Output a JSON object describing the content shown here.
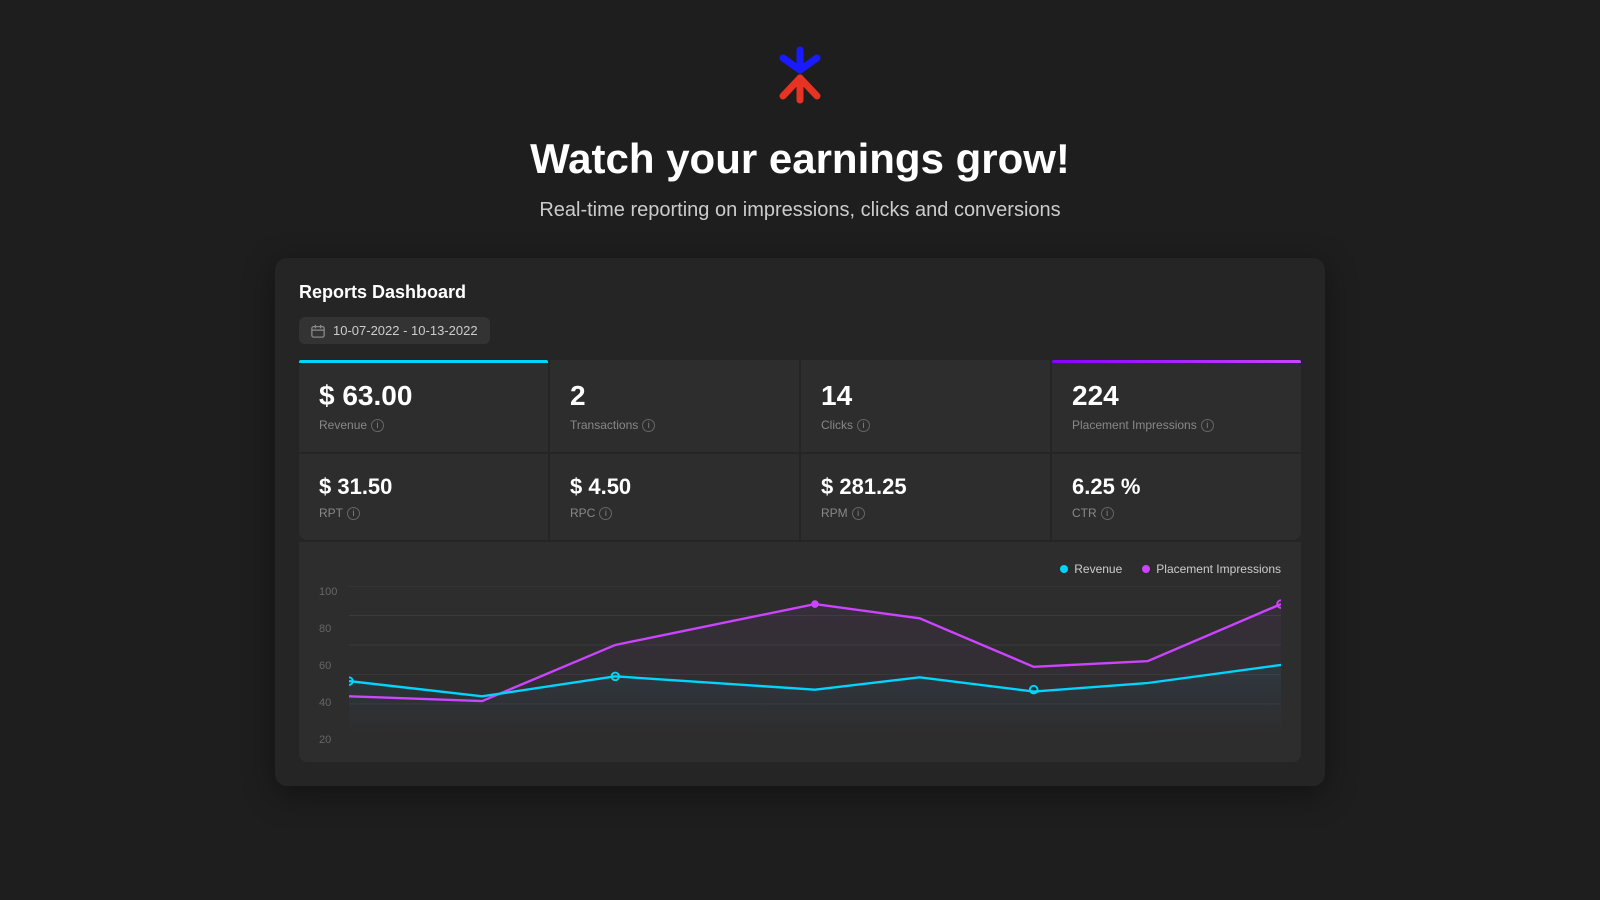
{
  "logo": {
    "alt": "Walmart Spark logo"
  },
  "header": {
    "headline": "Watch your earnings grow!",
    "subtitle": "Real-time reporting on impressions, clicks and conversions"
  },
  "dashboard": {
    "title": "Reports Dashboard",
    "date_range": "10-07-2022 - 10-13-2022",
    "top_metrics": [
      {
        "value": "$ 63.00",
        "label": "Revenue",
        "border_color": "cyan"
      },
      {
        "value": "2",
        "label": "Transactions",
        "border_color": "none"
      },
      {
        "value": "14",
        "label": "Clicks",
        "border_color": "none"
      },
      {
        "value": "224",
        "label": "Placement Impressions",
        "border_color": "purple"
      }
    ],
    "bottom_metrics": [
      {
        "value": "$ 31.50",
        "label": "RPT"
      },
      {
        "value": "$ 4.50",
        "label": "RPC"
      },
      {
        "value": "$ 281.25",
        "label": "RPM"
      },
      {
        "value": "6.25 %",
        "label": "CTR"
      }
    ],
    "chart": {
      "legend": [
        {
          "label": "Revenue",
          "color": "#00d4ff"
        },
        {
          "label": "Placement Impressions",
          "color": "#cc44ff"
        }
      ],
      "y_axis": [
        "100",
        "80",
        "60",
        "40",
        "20"
      ]
    }
  }
}
